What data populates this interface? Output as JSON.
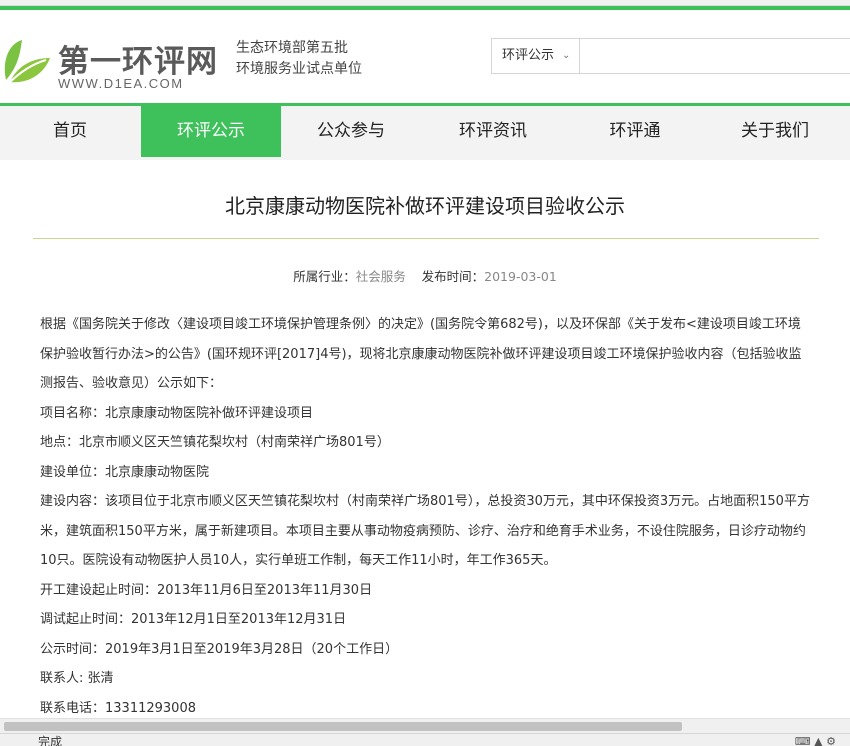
{
  "site": {
    "logo_cn": "第一环评网",
    "logo_en": "WWW.D1EA.COM",
    "slogan_line1": "生态环境部第五批",
    "slogan_line2": "环境服务业试点单位"
  },
  "search": {
    "category": "环评公示",
    "value": ""
  },
  "nav": {
    "items": [
      {
        "label": "首页"
      },
      {
        "label": "环评公示"
      },
      {
        "label": "公众参与"
      },
      {
        "label": "环评资讯"
      },
      {
        "label": "环评通"
      },
      {
        "label": "关于我们"
      }
    ],
    "active_color": "#3ec15a"
  },
  "article": {
    "title": "北京康康动物医院补做环评建设项目验收公示",
    "industry_label": "所属行业：",
    "industry_value": "社会服务",
    "date_label": "发布时间：",
    "date_value": "2019-03-01",
    "paragraphs": [
      "根据《国务院关于修改〈建设项目竣工环境保护管理条例〉的决定》(国务院令第682号)，以及环保部《关于发布<建设项目竣工环境保护验收暂行办法>的公告》(国环规环评[2017]4号)，现将北京康康动物医院补做环评建设项目竣工环境保护验收内容（包括验收监测报告、验收意见）公示如下：",
      "项目名称：北京康康动物医院补做环评建设项目",
      "地点：北京市顺义区天竺镇花梨坎村（村南荣祥广场801号）",
      "建设单位：北京康康动物医院",
      "建设内容：该项目位于北京市顺义区天竺镇花梨坎村（村南荣祥广场801号），总投资30万元，其中环保投资3万元。占地面积150平方米，建筑面积150平方米，属于新建项目。本项目主要从事动物疫病预防、诊疗、治疗和绝育手术业务，不设住院服务，日诊疗动物约10只。医院设有动物医护人员10人，实行单班工作制，每天工作11小时，年工作365天。",
      "开工建设起止时间：2013年11月6日至2013年11月30日",
      "调试起止时间：2013年12月1日至2013年12月31日",
      "公示时间：2019年3月1日至2019年3月28日（20个工作日）",
      "联系人: 张清",
      "联系电话：13311293008"
    ]
  },
  "statusbar": {
    "text": "完成"
  },
  "colors": {
    "brand_green": "#3ec15a",
    "divider": "#c7d88f"
  }
}
